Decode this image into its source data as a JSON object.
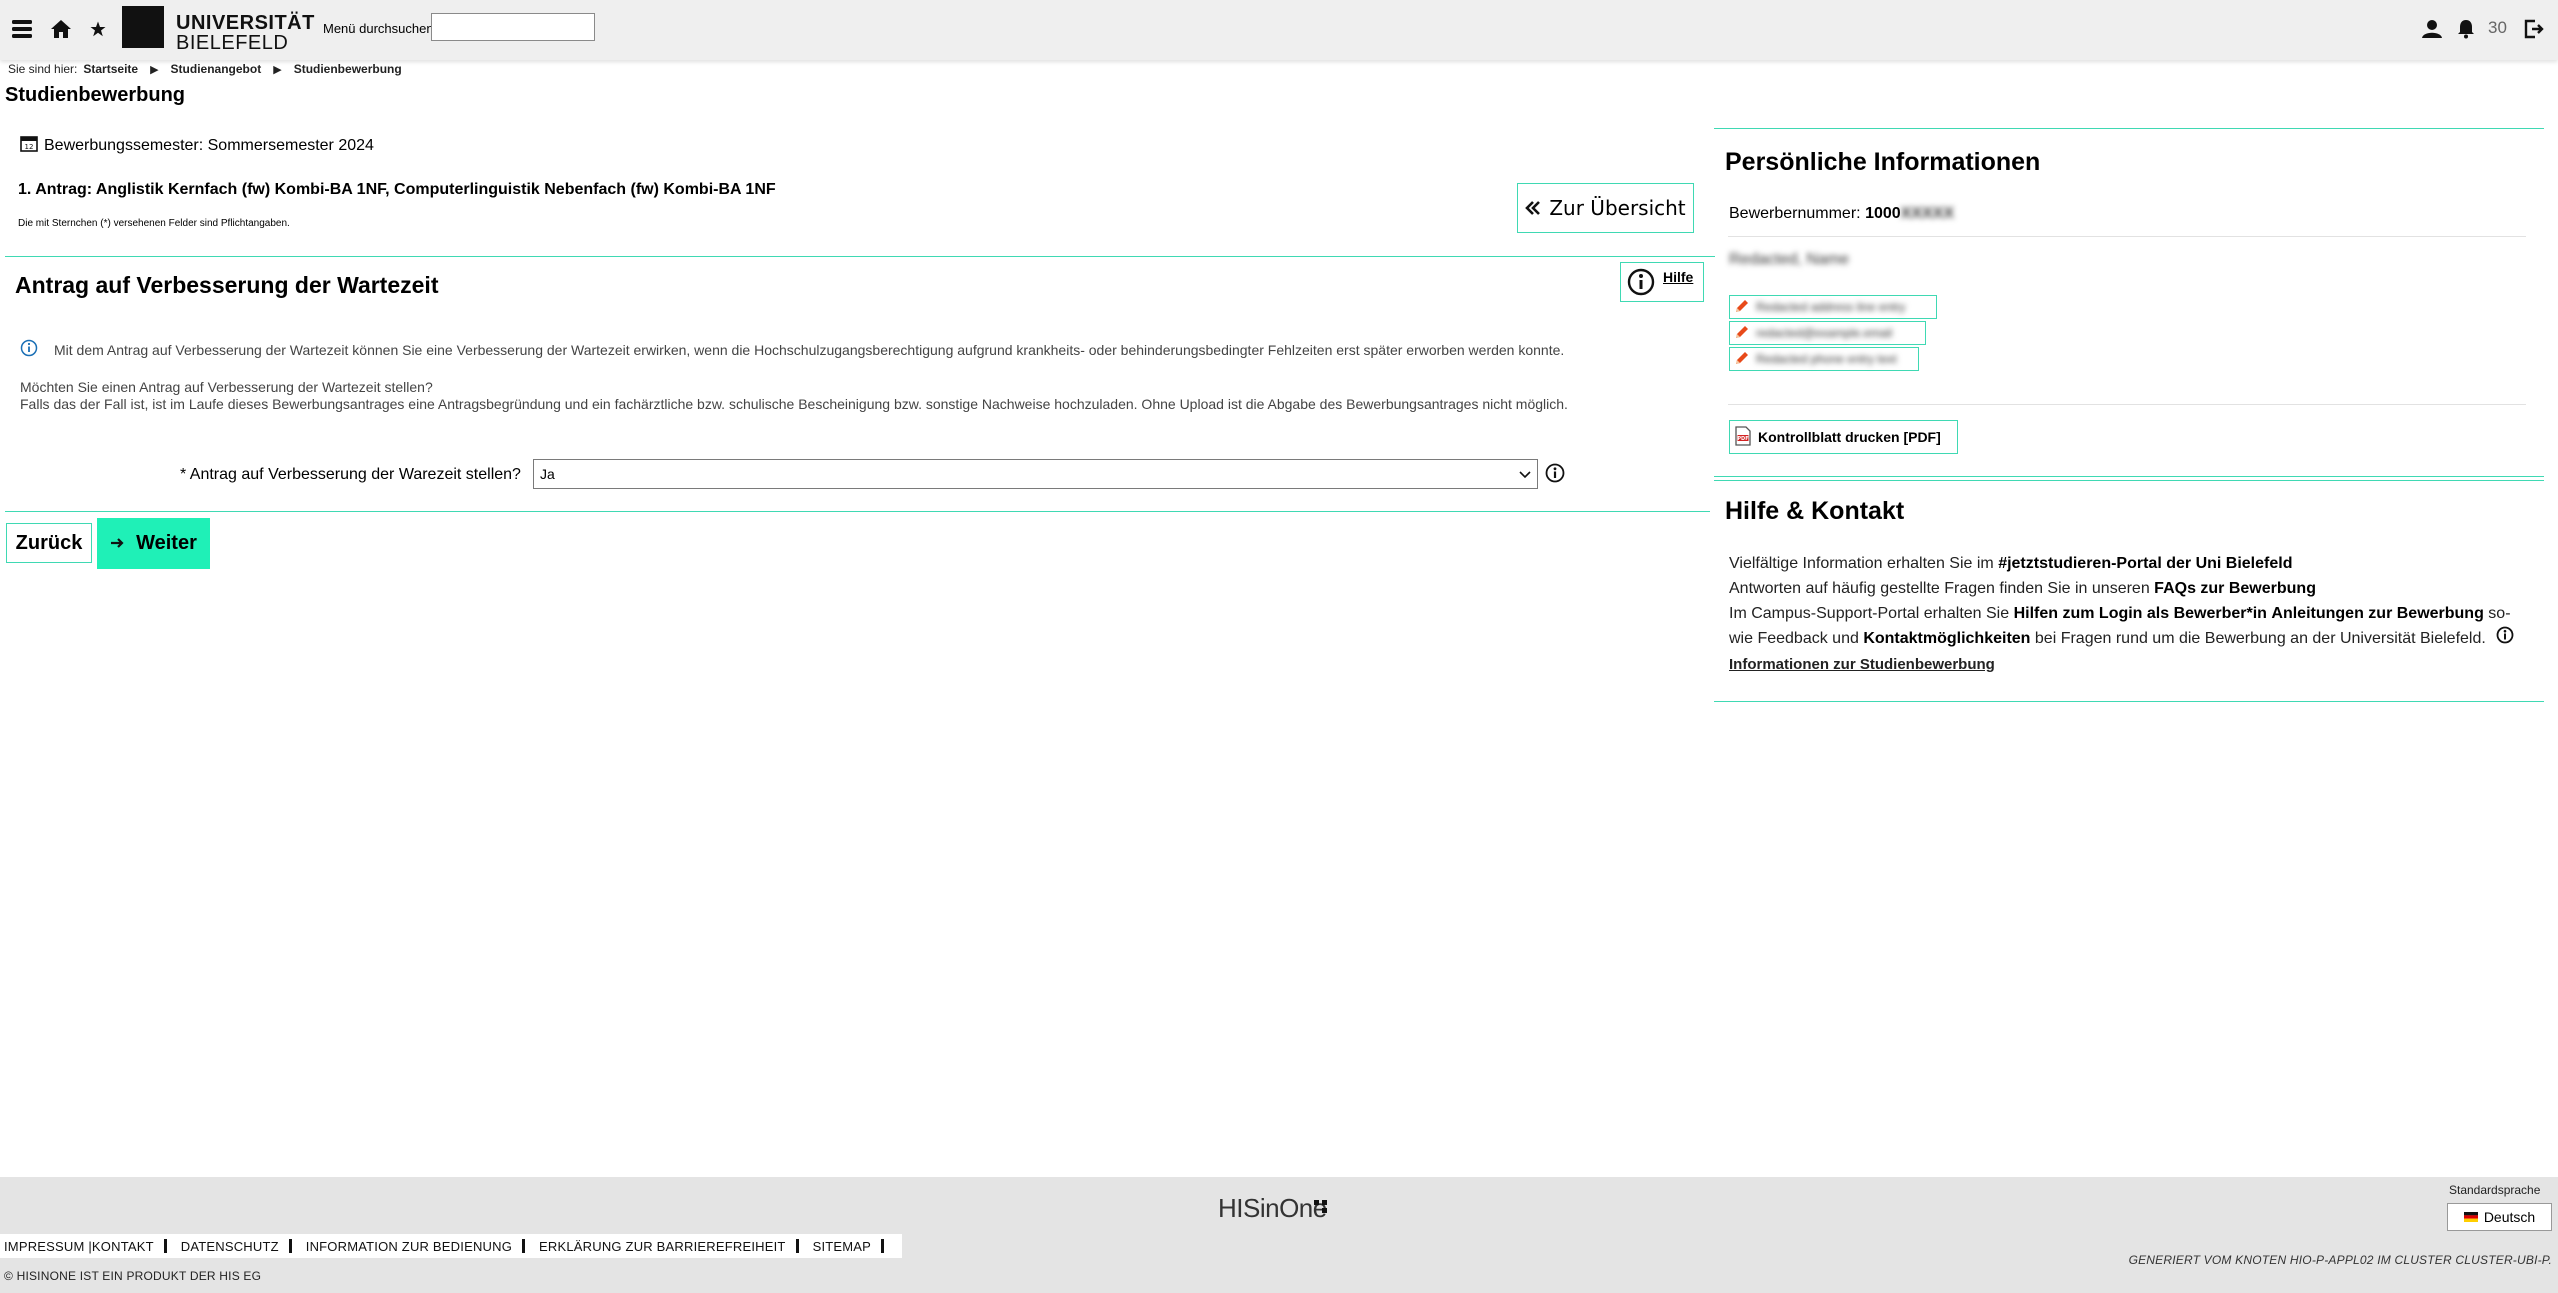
{
  "header": {
    "menu_search_label": "Menü durchsuchen",
    "menu_search_value": "",
    "logo_line1": "UNIVERSITÄT",
    "logo_line2": "BIELEFELD",
    "notification_count": "30"
  },
  "breadcrumb": {
    "prefix": "Sie sind hier:",
    "items": [
      "Startseite",
      "Studienangebot",
      "Studienbewerbung"
    ]
  },
  "page_title": "Studienbewerbung",
  "semester": "Bewerbungssemester: Sommersemester 2024",
  "antrag_title": "1. Antrag: Anglistik Kernfach (fw) Kombi-BA 1NF, Computerlinguistik Nebenfach (fw) Kombi-BA 1NF",
  "pflicht_note": "Die mit Sternchen (*) versehenen Felder sind Pflichtangaben.",
  "overview_button": "Zur Übersicht",
  "section_heading": "Antrag auf Verbesserung der Wartezeit",
  "help_button": "Hilfe",
  "info_text": "Mit dem Antrag auf Verbesserung der Wartezeit können Sie eine Verbesserung der Wartezeit erwirken, wenn die Hochschulzugangsberechtigung aufgrund krankheits- oder behinderungsbedingter Fehlzeiten erst später erworben werden konnte.",
  "question_line1": "Möchten Sie einen Antrag auf Verbesserung der Wartezeit stellen?",
  "question_line2": "Falls das der Fall ist, ist im Laufe dieses Bewerbungsantrages eine Antragsbegründung und ein fachärztliche bzw. schulische Bescheinigung bzw. sonstige Nachweise hochzuladen. Ohne Upload ist die Abgabe des Bewerbungsantrages nicht möglich.",
  "form": {
    "label": "* Antrag auf Verbesserung der Warezeit stellen?",
    "selected": "Ja"
  },
  "buttons": {
    "back": "Zurück",
    "next": "Weiter"
  },
  "personal_info": {
    "heading": "Persönliche Informationen",
    "applicant_label": "Bewerbernummer:",
    "applicant_number": "1000",
    "applicant_number_redacted": "XXXXX",
    "name_redacted": "Redacted, Name",
    "edit_rows": [
      "Redacted address line entry",
      "redacted@example.email",
      "Redacted phone entry text"
    ],
    "print_button": "Kontrollblatt drucken [PDF]"
  },
  "help_contact": {
    "heading": "Hilfe & Kontakt",
    "p1_text": "Vielfältige Information erhalten Sie im ",
    "p1_link": "#jetztstudieren-Portal der Uni Bielefeld",
    "p2_text": "Antworten auf häufig gestellte Fragen finden Sie in unseren ",
    "p2_link": "FAQs zur Bewerbung",
    "p3_text": "Im Campus-Support-Portal erhalten Sie ",
    "p3_link1": "Hilfen zum Login als Bewerber*in",
    "p3_link2": "Anleitungen zur Bewerbung",
    "p3_text2": " so-",
    "p4_text": "wie Feedback und ",
    "p4_link": "Kontaktmöglichkeiten",
    "p4_text2": " bei Fragen rund um die Bewerbung an der Universität Bielefeld.",
    "p5_link": "Informationen zur Studienbewerbung"
  },
  "footer": {
    "logo": "HISinOne",
    "std_lang_label": "Standardsprache",
    "lang_button": "Deutsch",
    "links": [
      "IMPRESSUM |KONTAKT",
      "DATENSCHUTZ",
      "INFORMATION ZUR BEDIENUNG",
      "ERKLÄRUNG ZUR BARRIEREFREIHEIT",
      "SITEMAP"
    ],
    "copyright": "© HISINONE IST EIN PRODUKT DER HIS EG",
    "generated": "GENERIERT VOM KNOTEN HIO-P-APPL02 IM CLUSTER CLUSTER-UBI-P."
  },
  "colors": {
    "accent": "#1ff0b7",
    "accent_border": "#3fd9b3",
    "footer_bg": "#e4e4e4"
  }
}
